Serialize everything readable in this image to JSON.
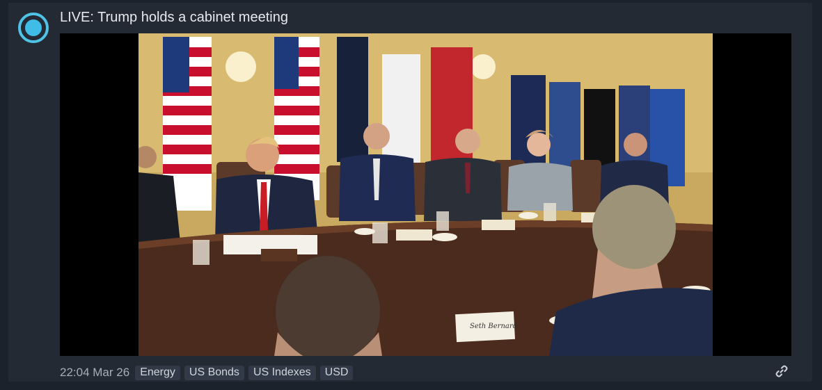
{
  "post": {
    "title": "LIVE: Trump holds a cabinet meeting",
    "timestamp": "22:04 Mar 26",
    "tags": [
      "Energy",
      "US Bonds",
      "US Indexes",
      "USD"
    ],
    "live_icon": "live-broadcast-icon",
    "link_icon": "link-icon"
  },
  "video": {
    "place_cards": [
      "Seth Bernard"
    ]
  },
  "colors": {
    "accent": "#4fc3e6",
    "card_bg": "#232a34",
    "page_bg": "#1c222b",
    "tag_bg": "#313a46"
  }
}
